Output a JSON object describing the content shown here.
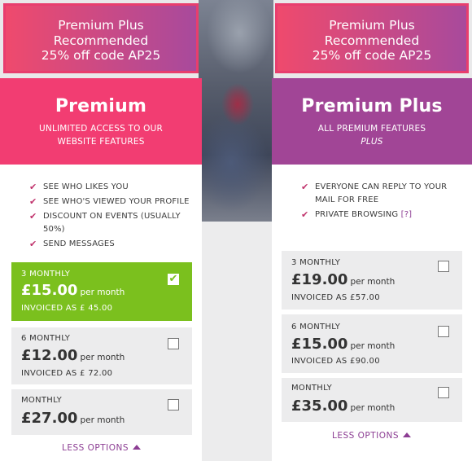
{
  "promo": {
    "line1": "Premium Plus",
    "line2": "Recommended",
    "line3": "25% off code AP25"
  },
  "plans": {
    "premium": {
      "name": "Premium",
      "subtitle_1": "UNLIMITED ACCESS TO OUR",
      "subtitle_2": "WEBSITE FEATURES",
      "features": [
        "SEE WHO LIKES YOU",
        "SEE WHO'S VIEWED YOUR PROFILE",
        "DISCOUNT ON EVENTS (USUALLY 50%)",
        "SEND MESSAGES"
      ],
      "options": [
        {
          "period": "3 MONTHLY",
          "price": "£15.00",
          "per": "per month",
          "invoiced": "INVOICED AS £ 45.00",
          "selected": true
        },
        {
          "period": "6 MONTHLY",
          "price": "£12.00",
          "per": "per month",
          "invoiced": "INVOICED AS £ 72.00",
          "selected": false
        },
        {
          "period": "MONTHLY",
          "price": "£27.00",
          "per": "per month",
          "invoiced": "",
          "selected": false
        }
      ],
      "less_options": "LESS OPTIONS"
    },
    "premium_plus": {
      "name": "Premium Plus",
      "subtitle_1": "ALL PREMIUM FEATURES",
      "subtitle_2": "PLUS",
      "features": [
        "EVERYONE CAN REPLY TO YOUR MAIL FOR FREE",
        "PRIVATE BROWSING"
      ],
      "help_link": "[?]",
      "options": [
        {
          "period": "3 MONTHLY",
          "price": "£19.00",
          "per": "per month",
          "invoiced": "INVOICED AS £57.00",
          "selected": false
        },
        {
          "period": "6 MONTHLY",
          "price": "£15.00",
          "per": "per month",
          "invoiced": "INVOICED AS £90.00",
          "selected": false
        },
        {
          "period": "MONTHLY",
          "price": "£35.00",
          "per": "per month",
          "invoiced": "",
          "selected": false
        }
      ],
      "less_options": "LESS OPTIONS"
    }
  },
  "icons": {
    "feature_check": "check-icon",
    "selected_checkbox": "checkbox-checked-icon",
    "empty_checkbox": "checkbox-empty-icon",
    "less_arrow": "triangle-up-icon"
  },
  "colors": {
    "premium_pink": "#f23d72",
    "premium_plus_purple": "#a14596",
    "selected_green": "#7bc01e",
    "link_purple": "#8c3d93",
    "check_color": "#c0336c",
    "option_grey": "#ececed"
  }
}
